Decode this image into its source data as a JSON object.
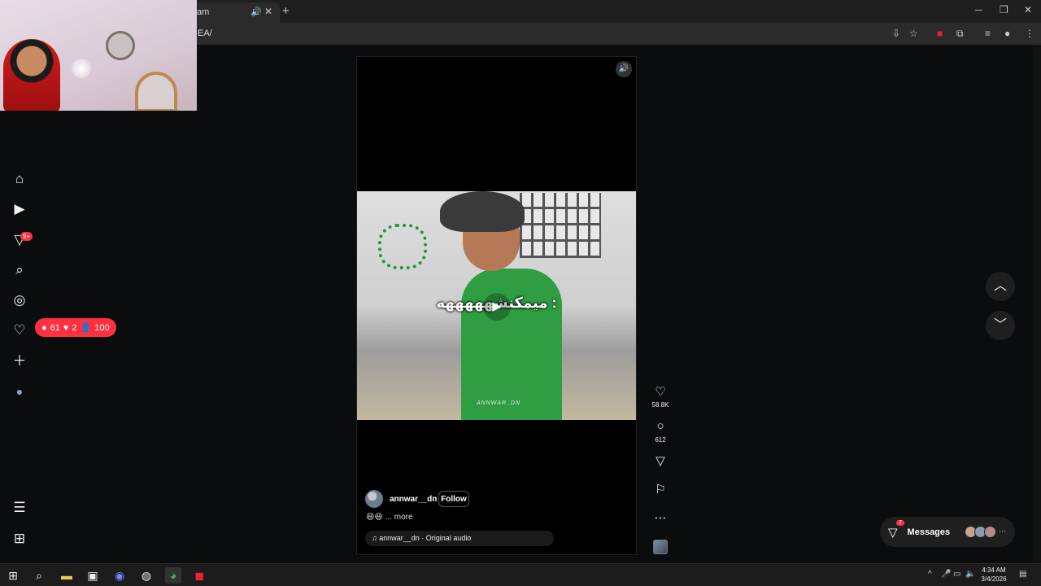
{
  "browser": {
    "tab_title": "am",
    "tab_audio_icon": "speaker-icon",
    "tab_close": "✕",
    "new_tab": "+",
    "url": "EA/",
    "window_controls": {
      "minimize": "─",
      "restore": "❐",
      "close": "✕"
    }
  },
  "sidebar": {
    "notifications_badge": "9+",
    "activity": {
      "comments": "61",
      "likes": "2",
      "followers": "100"
    }
  },
  "reel": {
    "caption_overlay": "میمکنشهههههه :",
    "watermark": "ANNWAR_DN",
    "username": "annwar__dn",
    "follow_label": "Follow",
    "description_emoji": "😆😆",
    "description_more": "... more",
    "audio_label": "annwar__dn · Original audio",
    "likes_count": "58.8K",
    "comments_count": "612"
  },
  "messages": {
    "label": "Messages",
    "badge": "7"
  },
  "taskbar": {
    "time": "4:34 AM",
    "date": "3/4/2026"
  },
  "colors": {
    "accent_red": "#ff3040",
    "background": "#0b0c0e"
  }
}
